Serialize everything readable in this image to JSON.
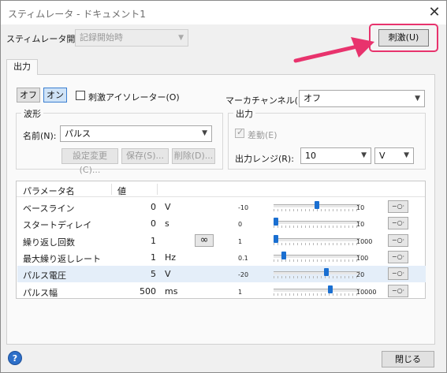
{
  "window": {
    "title": "スティムレータ - ドキュメント1",
    "close_glyph": "✕"
  },
  "header": {
    "stim_period_label": "スティムレータ開",
    "stim_period_value": "記録開始時",
    "stimulate_button": "刺激(U)"
  },
  "tab_label": "出力",
  "toggle": {
    "off": "オフ",
    "on": "オン"
  },
  "isolator_label": "刺激アイソレーター(O)",
  "marker": {
    "label": "マーカチャンネル(K):",
    "value": "オフ"
  },
  "waveform": {
    "group_label": "波形",
    "name_label": "名前(N):",
    "name_value": "パルス",
    "buttons": [
      "設定変更(C)...",
      "保存(S)...",
      "削除(D)..."
    ]
  },
  "output": {
    "group_label": "出力",
    "differential_label": "差動(E)",
    "range_label": "出力レンジ(R):",
    "range_value": "10",
    "unit_value": "V"
  },
  "table": {
    "columns": [
      "パラメータ名",
      "値"
    ],
    "rows": [
      {
        "name": "ベースライン",
        "value": "0",
        "unit": "V",
        "min": "-10",
        "max": "10",
        "slider": 0.5,
        "selected": false
      },
      {
        "name": "スタートディレイ",
        "value": "0",
        "unit": "s",
        "min": "0",
        "max": "10",
        "slider": 0.0,
        "selected": false
      },
      {
        "name": "繰り返し回数",
        "value": "1",
        "unit": "",
        "min": "1",
        "max": "1000",
        "slider": 0.0,
        "selected": false
      },
      {
        "name": "最大繰り返しレート",
        "value": "1",
        "unit": "Hz",
        "min": "0.1",
        "max": "100",
        "slider": 0.1,
        "selected": false
      },
      {
        "name": "パルス電圧",
        "value": "5",
        "unit": "V",
        "min": "-20",
        "max": "20",
        "slider": 0.62,
        "selected": true
      },
      {
        "name": "パルス幅",
        "value": "500",
        "unit": "ms",
        "min": "1",
        "max": "10000",
        "slider": 0.66,
        "selected": false
      }
    ],
    "infinity_glyph": "∞",
    "row_button_glyph": "−○·"
  },
  "footer": {
    "help_glyph": "?",
    "close_button": "閉じる"
  },
  "colors": {
    "accent": "#1a6fd1",
    "annotation": "#e8336d",
    "selected_row": "#e4eef9"
  }
}
